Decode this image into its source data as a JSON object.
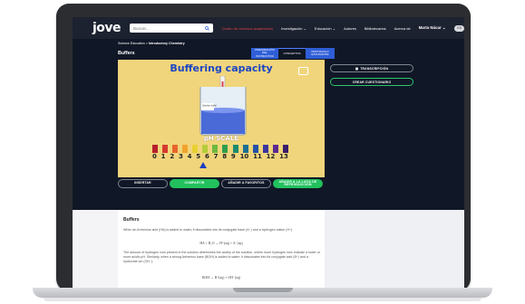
{
  "nav": {
    "logo": "jove",
    "search_placeholder": "Buscar...",
    "red_link": "Centro de recursos académicos",
    "items": [
      "Investigación",
      "Educación",
      "Autores",
      "Bibliotecarios",
      "Acerca de"
    ],
    "user": "Marta Núcar",
    "lang": "ES"
  },
  "breadcrumb": {
    "root": "Science Education",
    "separator": ">",
    "current": "Introductory Chemistry"
  },
  "page_title": "Buffers",
  "tabs": [
    "PREPARACIÓN DEL INSTRUCTOR",
    "CONCEPTOS",
    "PROTOCOLO ESTUDIANTE"
  ],
  "video": {
    "title": "Buffering capacity",
    "ph_label": "pH SCALE",
    "ph_numbers": [
      "0",
      "1",
      "2",
      "3",
      "4",
      "5",
      "6",
      "7",
      "8",
      "9",
      "10",
      "11",
      "12",
      "13"
    ],
    "swatch_colors": [
      "#b7202c",
      "#d33a2e",
      "#e8652d",
      "#f0a32c",
      "#e9d032",
      "#b6cc3a",
      "#6cb83e",
      "#2f9e4e",
      "#1d8a6e",
      "#1c6f92",
      "#2351a6",
      "#3a36a0",
      "#5b2c8f",
      "#3a1d6b"
    ],
    "beaker_label": "Solution buffer"
  },
  "actions": [
    "INSERTAR",
    "COMPARTIR",
    "AÑADIR A FAVORITOS",
    "AÑADIR A LA LISTA DE REPRODUCCIÓN"
  ],
  "side_buttons": [
    "TRANSCRIPCIÓN",
    "CREAR CUESTIONARIO"
  ],
  "content": {
    "title": "Buffers",
    "p1": "When an Arrhenius acid (HA) is added to water, it dissociates into its conjugate base (A⁻) and a hydrogen cation (H⁺).",
    "eq1": "HA + H₂O → H⁺(aq) + A⁻(aq)",
    "p2": "The amount of hydrogen ions present in the solution determines the acidity of the solution, where more hydrogen ions indicate a lower or more acidic pH. Similarly, when a strong Arrhenius base (BOH) is added to water, it dissociates into its conjugate acid (B⁺) and a hydroxide ion (OH⁻).",
    "eq2": "BOH → B⁺(aq) + OH⁻(aq)"
  }
}
